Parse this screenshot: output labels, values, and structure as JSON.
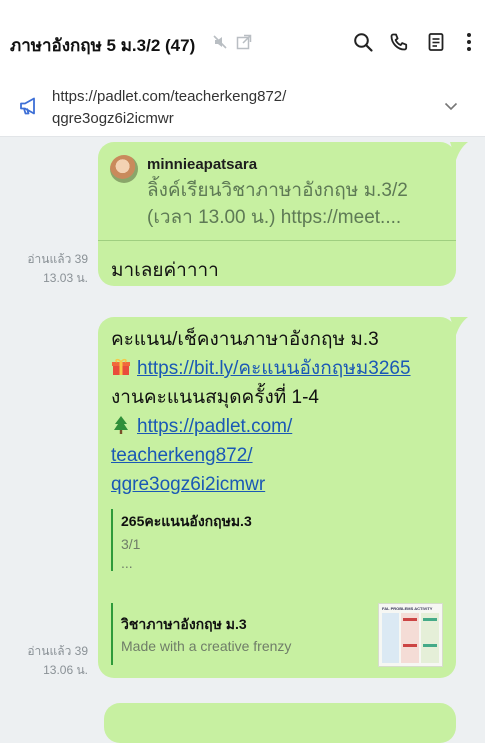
{
  "header": {
    "title": "ภาษาอังกฤษ 5 ม.3/2 (47)",
    "icons": [
      "mute-icon",
      "popout-icon",
      "search-icon",
      "phone-icon",
      "notes-icon",
      "more-icon"
    ]
  },
  "pinned": {
    "line1": "https://padlet.com/teacherkeng872/",
    "line2": "qgre3ogz6i2icmwr"
  },
  "messages": [
    {
      "reply": {
        "username": "minnieapatsara",
        "line1": "ลิ้งค์เรียนวิชาภาษาอังกฤษ ม.3/2",
        "line2": "(เวลา 13.00 น.) https://meet...."
      },
      "text": "มาเลยค่าาาา",
      "read_label": "อ่านแล้ว 39",
      "time": "13.03 น."
    },
    {
      "line1": "คะแนน/เช็คงานภาษาอังกฤษ ม.3",
      "link1": "https://bit.ly/คะแนนอังกฤษม3265",
      "line3": "งานคะแนนสมุดครั้งที่ 1-4",
      "link2_a": "https://padlet.com/",
      "link2_b": "teacherkeng872/",
      "link2_c": "qgre3ogz6i2icmwr",
      "preview1": {
        "title": "265คะแนนอังกฤษม.3",
        "sub1": "3/1",
        "sub2": "..."
      },
      "preview2": {
        "title": "วิชาภาษาอังกฤษ ม.3",
        "sub": "Made with a creative frenzy",
        "thumb_caption": "FAL PROBLEMS ACTIVITY"
      },
      "read_label": "อ่านแล้ว 39",
      "time": "13.06 น."
    }
  ],
  "colors": {
    "bubble": "#c7f0a1",
    "link": "#1a58b5",
    "accent_bar": "#2e9b3a"
  }
}
